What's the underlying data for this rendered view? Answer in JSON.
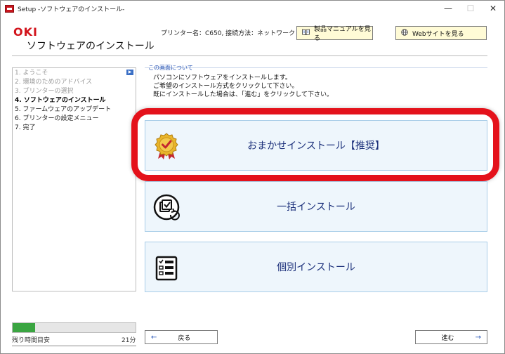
{
  "window": {
    "title": "Setup -ソフトウェアのインストール-",
    "minimize": "—",
    "maximize": "☐",
    "close": "✕"
  },
  "header": {
    "logo": "OKI",
    "page_title": "ソフトウェアのインストール",
    "printer_info": "プリンター名：C650, 接続方法：ネットワーク",
    "manual_button": "製品マニュアルを見る",
    "web_button": "Webサイトを見る"
  },
  "steps": [
    {
      "label": "1. ようこそ",
      "state": "done"
    },
    {
      "label": "2. 環境のためのアドバイス",
      "state": "done"
    },
    {
      "label": "3. プリンターの選択",
      "state": "done"
    },
    {
      "label": "4. ソフトウェアのインストール",
      "state": "active"
    },
    {
      "label": "5. ファームウェアのアップデート",
      "state": "pending"
    },
    {
      "label": "6. プリンターの設定メニュー",
      "state": "pending"
    },
    {
      "label": "7. 完了",
      "state": "pending"
    }
  ],
  "progress": {
    "fraction": 0.18,
    "label": "残り時間目安",
    "remaining": "21分"
  },
  "info": {
    "title": "この画面について",
    "lines": [
      "パソコンにソフトウェアをインストールします。",
      "ご希望のインストール方式をクリックして下さい。",
      "既にインストールした場合は、「進む」をクリックして下さい。"
    ]
  },
  "options": {
    "recommended": "おまかせインストール【推奨】",
    "bulk": "一括インストール",
    "individual": "個別インストール"
  },
  "nav": {
    "back": "戻る",
    "next": "進む"
  },
  "colors": {
    "brand": "#d2141c",
    "highlight": "#e4121b",
    "progress": "#3aa541",
    "option_bg": "#eef6fc"
  }
}
